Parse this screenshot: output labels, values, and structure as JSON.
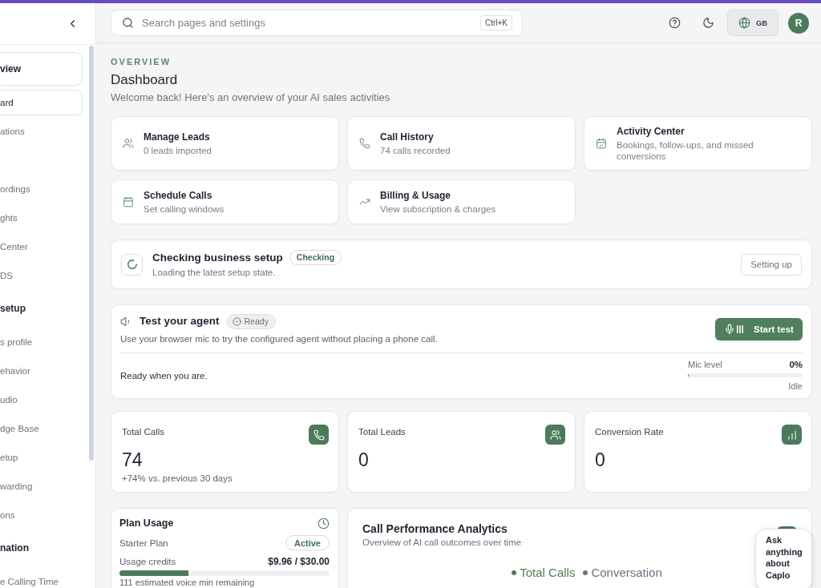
{
  "sidebar": {
    "groups": [
      {
        "title": "view",
        "active": true,
        "items": [
          {
            "label": "ard",
            "selected": true
          },
          {
            "label": "ations",
            "selected": false
          },
          {
            "label": "ordings",
            "selected": false
          },
          {
            "label": "ghts",
            "selected": false
          },
          {
            "label": "Center",
            "selected": false
          },
          {
            "label": "DS",
            "selected": false
          }
        ]
      },
      {
        "title": "setup",
        "active": false,
        "items": [
          {
            "label": "s profile",
            "selected": false
          },
          {
            "label": "ehavior",
            "selected": false
          },
          {
            "label": "udio",
            "selected": false
          },
          {
            "label": "dge Base",
            "selected": false
          },
          {
            "label": "etup",
            "selected": false
          },
          {
            "label": "warding",
            "selected": false
          },
          {
            "label": "ons",
            "selected": false
          }
        ]
      },
      {
        "title": "nation",
        "active": false,
        "items": [
          {
            "label": "e Calling Time",
            "selected": false
          }
        ]
      }
    ]
  },
  "topbar": {
    "search": {
      "placeholder": "Search pages and settings",
      "shortcut": "Ctrl+K"
    },
    "language": "GB",
    "avatar": "R"
  },
  "header": {
    "eyebrow": "OVERVIEW",
    "title": "Dashboard",
    "subtitle": "Welcome back! Here's an overview of your AI sales activities"
  },
  "quick_links": [
    {
      "title": "Manage Leads",
      "subtitle": "0 leads imported"
    },
    {
      "title": "Call History",
      "subtitle": "74 calls recorded"
    },
    {
      "title": "Activity Center",
      "subtitle": "Bookings, follow-ups, and missed conversions"
    },
    {
      "title": "Schedule Calls",
      "subtitle": "Set calling windows"
    },
    {
      "title": "Billing & Usage",
      "subtitle": "View subscription & charges"
    }
  ],
  "setup": {
    "title": "Checking business setup",
    "badge": "Checking",
    "subtitle": "Loading the latest setup state.",
    "button": "Setting up"
  },
  "agent": {
    "title": "Test your agent",
    "badge": "Ready",
    "description": "Use your browser mic to try the configured agent without placing a phone call.",
    "button": "Start test",
    "status": "Ready when you are.",
    "meter": {
      "label": "Mic level",
      "reading": "0%",
      "level": 0,
      "state": "Idle"
    }
  },
  "stats": [
    {
      "label": "Total Calls",
      "value": "74",
      "note": "+74% vs. previous 30 days"
    },
    {
      "label": "Total Leads",
      "value": "0"
    },
    {
      "label": "Conversion Rate",
      "value": "0"
    }
  ],
  "plan": {
    "title": "Plan Usage",
    "plan_name": "Starter Plan",
    "badge": "Active",
    "credits_label": "Usage credits",
    "credits": "$9.96 / $30.00",
    "level": 0.33,
    "note": "111 estimated voice min remaining"
  },
  "analytics": {
    "title": "Call Performance Analytics",
    "subtitle": "Overview of AI call outcomes over time",
    "legend": [
      {
        "label": "Total Calls",
        "color": "#4e7d5b"
      },
      {
        "label": "Conversation",
        "color": "#6b7280"
      }
    ]
  },
  "chat": {
    "text": "Ask anything about Caplo"
  }
}
